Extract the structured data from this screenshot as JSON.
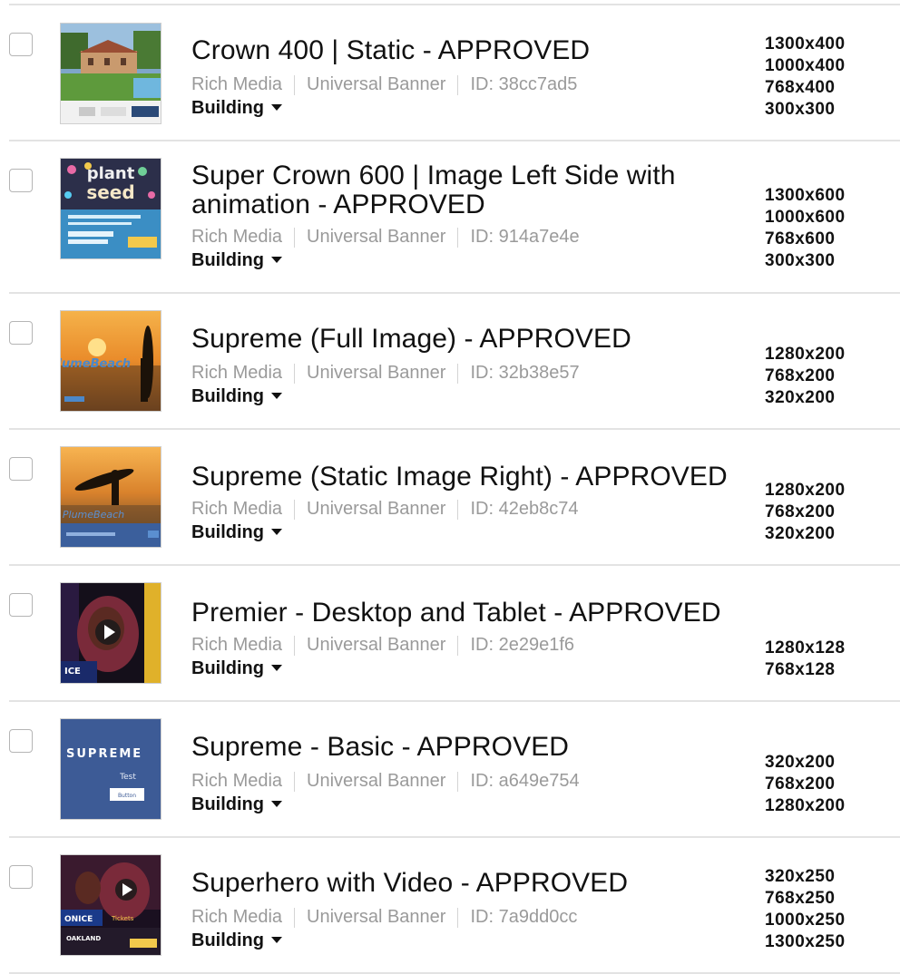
{
  "rows": [
    {
      "title": "Crown 400 | Static - APPROVED",
      "type": "Rich Media",
      "format": "Universal Banner",
      "id": "ID: 38cc7ad5",
      "status": "Building",
      "sizes": [
        "1300x400",
        "1000x400",
        "768x400",
        "300x300"
      ],
      "thumb": "house-icon"
    },
    {
      "title": "Super Crown 600 | Image Left Side with animation - APPROVED",
      "type": "Rich Media",
      "format": "Universal Banner",
      "id": "ID: 914a7e4e",
      "status": "Building",
      "sizes": [
        "1300x600",
        "1000x600",
        "768x600",
        "300x300"
      ],
      "thumb": "seeds-icon"
    },
    {
      "title": "Supreme (Full Image) - APPROVED",
      "type": "Rich Media",
      "format": "Universal Banner",
      "id": "ID: 32b38e57",
      "status": "Building",
      "sizes": [
        "1280x200",
        "768x200",
        "320x200"
      ],
      "thumb": "sunset-icon"
    },
    {
      "title": "Supreme (Static Image Right) - APPROVED",
      "type": "Rich Media",
      "format": "Universal Banner",
      "id": "ID: 42eb8c74",
      "status": "Building",
      "sizes": [
        "1280x200",
        "768x200",
        "320x200"
      ],
      "thumb": "surfer-icon"
    },
    {
      "title": "Premier - Desktop and Tablet - APPROVED",
      "type": "Rich Media",
      "format": "Universal Banner",
      "id": "ID: 2e29e1f6",
      "status": "Building",
      "sizes": [
        "1280x128",
        "768x128"
      ],
      "thumb": "video-icon"
    },
    {
      "title": "Supreme - Basic - APPROVED",
      "type": "Rich Media",
      "format": "Universal Banner",
      "id": "ID: a649e754",
      "status": "Building",
      "sizes": [
        "320x200",
        "768x200",
        "1280x200"
      ],
      "thumb": "supreme-basic-icon",
      "thumb_text": {
        "heading": "SUPREME",
        "sub": "Test",
        "button": "Button"
      }
    },
    {
      "title": "Superhero with Video - APPROVED",
      "type": "Rich Media",
      "format": "Universal Banner",
      "id": "ID: 7a9dd0cc",
      "status": "Building",
      "sizes": [
        "320x250",
        "768x250",
        "1000x250",
        "1300x250"
      ],
      "thumb": "superhero-video-icon"
    }
  ],
  "colors": {
    "separator": "#e3e3e3",
    "meta_text": "#9a9a9a",
    "title_text": "#111111"
  }
}
